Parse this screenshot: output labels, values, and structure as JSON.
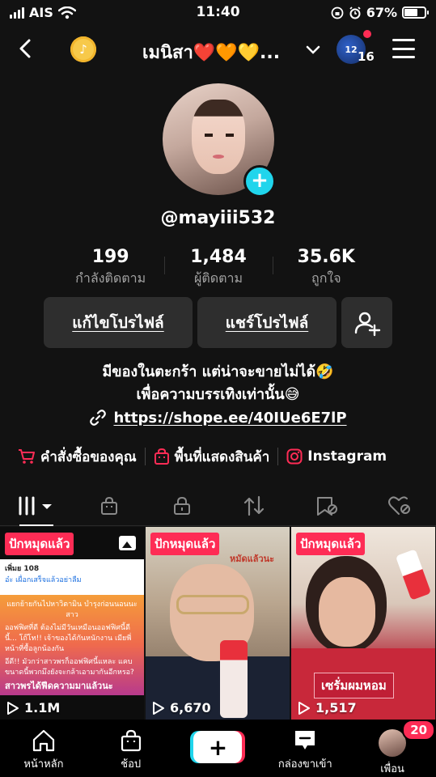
{
  "status_bar": {
    "carrier": "AIS",
    "time": "11:40",
    "battery": "67%",
    "battery_level": 0.67
  },
  "nav": {
    "title": "เมนิสา❤️🧡💛...",
    "avatar_text": "12",
    "notification_count": "16"
  },
  "profile": {
    "username": "@mayiii532",
    "stats": [
      {
        "number": "199",
        "label": "กำลังติดตาม"
      },
      {
        "number": "1,484",
        "label": "ผู้ติดตาม"
      },
      {
        "number": "35.6K",
        "label": "ถูกใจ"
      }
    ],
    "edit_button": "แก้ไขโปรไฟล์",
    "share_button": "แชร์โปรไฟล์",
    "bio_line1": "มีของในตะกร้า แต่น่าจะขายไม่ได้🤣",
    "bio_line2": "เพื่อความบรรเทิงเท่านั้น😅",
    "link": "https://shope.ee/40IUe6E7lP"
  },
  "shortcuts": {
    "orders": "คำสั่งซื้อของคุณ",
    "showcase": "พื้นที่แสดงสินค้า",
    "instagram": "Instagram"
  },
  "videos": [
    {
      "pinned_label": "ปักหมุดแล้ว",
      "views": "1.1M",
      "card_header": "เพิ่มย 108",
      "card_subtext": "อ๋ะ เผื่อกเสร็จแล้วอย่าลืม",
      "card_body_1": "แยกย้ายกันไปหาวิตามิน บำรุงก่อนนอนนะสาว",
      "card_body_2": "ออฟฟิศที่ดี ต้องไม่มีวันเหมือนออฟฟิศนี้ดีนี้... โถ๊โท!! เจ้าของได้กันหนักงาน เมียพี่หน้าที่ซื้อลูกน้องกัน",
      "card_body_3": "อีดี!! มัวกว่าสาวพรก็ออฟฟิศนี้แหละ แคบ ขนาดนี้พวกมึงยังจะกล้าเอามากันอีกหรอ?",
      "card_body_4": "สาวพรได้ฟีดความมาแล้วนะ"
    },
    {
      "pinned_label": "ปักหมุดแล้ว",
      "views": "6,670",
      "overlay_text": "หมัดแล้วนะ"
    },
    {
      "pinned_label": "ปักหมุดแล้ว",
      "views": "1,517",
      "caption": "เซรั่มผมหอม"
    }
  ],
  "bottom_nav": {
    "home": "หน้าหลัก",
    "shop": "ช้อป",
    "inbox": "กล่องขาเข้า",
    "friends": "เพื่อน",
    "friends_badge": "20"
  },
  "colors": {
    "accent": "#fe2c55",
    "cyan": "#20d5ec",
    "background": "#121212"
  }
}
